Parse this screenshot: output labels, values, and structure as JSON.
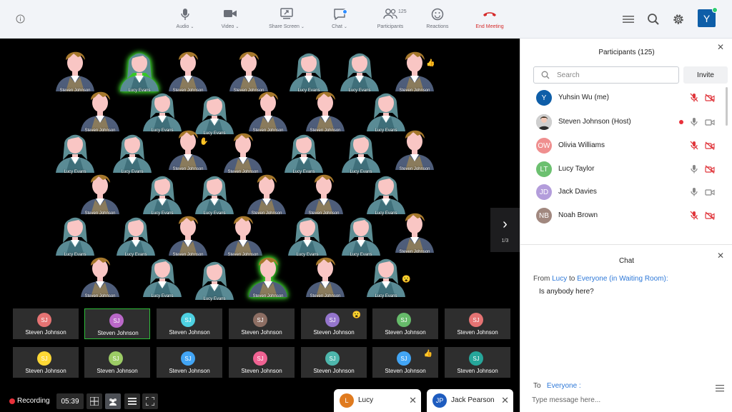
{
  "toolbar": {
    "info_icon": "info-icon",
    "buttons": [
      {
        "id": "audio",
        "label": "Audio",
        "icon": "microphone-icon",
        "caret": "⌄"
      },
      {
        "id": "video",
        "label": "Video",
        "icon": "video-camera-icon",
        "caret": "⌄"
      },
      {
        "id": "share",
        "label": "Share Screen",
        "icon": "share-screen-icon",
        "caret": "⌄"
      },
      {
        "id": "chat",
        "label": "Chat",
        "icon": "chat-bubble-icon",
        "caret": "⌄"
      },
      {
        "id": "participants",
        "label": "Participants",
        "icon": "participants-icon",
        "badge": "125"
      },
      {
        "id": "reactions",
        "label": "Reactions",
        "icon": "smiley-icon"
      },
      {
        "id": "end",
        "label": "End Meeting",
        "icon": "phone-hangup-icon"
      }
    ],
    "avatar_initial": "Y",
    "colors": {
      "end": "#d52b2b",
      "accent": "#2d8cff",
      "avatar": "#0e5ea8"
    }
  },
  "gallery": {
    "people": [
      {
        "name": "Steven Johnson"
      },
      {
        "name": "Lucy Evans"
      },
      {
        "name": "Steven Johnson"
      },
      {
        "name": "Steven Johnson"
      },
      {
        "name": "Lucy Evans"
      },
      {
        "name": "Lucy Evans"
      },
      {
        "name": "Steven Johnson"
      },
      {
        "name": "Steven Johnson"
      },
      {
        "name": "Lucy Evans"
      },
      {
        "name": "Lucy Evans"
      },
      {
        "name": "Steven Johnson"
      },
      {
        "name": "Steven Johnson"
      },
      {
        "name": "Lucy Evans"
      },
      {
        "name": "Lucy Evans"
      },
      {
        "name": "Lucy Evans"
      },
      {
        "name": "Steven Johnson"
      },
      {
        "name": "Steven Johnson"
      },
      {
        "name": "Lucy Evans"
      },
      {
        "name": "Lucy Evans"
      },
      {
        "name": "Steven Johnson"
      },
      {
        "name": "Steven Johnson"
      },
      {
        "name": "Lucy Evans"
      },
      {
        "name": "Lucy Evans"
      },
      {
        "name": "Steven Johnson"
      },
      {
        "name": "Steven Johnson"
      },
      {
        "name": "Lucy Evans"
      },
      {
        "name": "Lucy Evans"
      },
      {
        "name": "Lucy Evans"
      },
      {
        "name": "Steven Johnson"
      },
      {
        "name": "Steven Johnson"
      },
      {
        "name": "Lucy Evans"
      },
      {
        "name": "Lucy Evans"
      },
      {
        "name": "Steven Johnson"
      },
      {
        "name": "Steven Johnson"
      },
      {
        "name": "Lucy Evans"
      },
      {
        "name": "Lucy Evans"
      },
      {
        "name": "Steven Johnson"
      },
      {
        "name": "Steven Johnson"
      },
      {
        "name": "Lucy Evans"
      }
    ],
    "pager": {
      "label": "1/3",
      "icon": "chevron-right-icon"
    },
    "tiles_row1": [
      {
        "initials": "SJ",
        "name": "Steven Johnson",
        "color": "#e57373"
      },
      {
        "initials": "SJ",
        "name": "Steven Johnson",
        "color": "#ba68c8"
      },
      {
        "initials": "SJ",
        "name": "Steven Johnson",
        "color": "#4dd0e1"
      },
      {
        "initials": "SJ",
        "name": "Steven Johnson",
        "color": "#8d6e63"
      },
      {
        "initials": "SJ",
        "name": "Steven Johnson",
        "color": "#9575cd"
      },
      {
        "initials": "SJ",
        "name": "Steven Johnson",
        "color": "#66bb6a"
      },
      {
        "initials": "SJ",
        "name": "Steven Johnson",
        "color": "#e57373"
      }
    ],
    "tiles_row2": [
      {
        "initials": "SJ",
        "name": "Steven Johnson",
        "color": "#fdd835"
      },
      {
        "initials": "SJ",
        "name": "Steven Johnson",
        "color": "#9ccc65"
      },
      {
        "initials": "SJ",
        "name": "Steven Johnson",
        "color": "#42a5f5"
      },
      {
        "initials": "SJ",
        "name": "Steven Johnson",
        "color": "#f06292"
      },
      {
        "initials": "SJ",
        "name": "Steven Johnson",
        "color": "#4db6ac"
      },
      {
        "initials": "SJ",
        "name": "Steven Johnson",
        "color": "#42a5f5"
      },
      {
        "initials": "SJ",
        "name": "Steven Johnson",
        "color": "#26a69a"
      }
    ]
  },
  "bottom": {
    "recording_label": "Recording",
    "timer": "05:39",
    "chips": [
      {
        "initial": "L",
        "name": "Lucy",
        "color": "#e07b1f"
      },
      {
        "initial": "JP",
        "name": "Jack Pearson",
        "color": "#1e5cbf"
      }
    ]
  },
  "participants": {
    "title": "Participants (125)",
    "search_placeholder": "Search",
    "invite_label": "Invite",
    "list": [
      {
        "initials": "Y",
        "name": "Yuhsin Wu (me)",
        "color": "#0e5ea8",
        "mic": "muted",
        "cam": "off"
      },
      {
        "initials": "",
        "name": "Steven Johnson (Host)",
        "color": "#9e9e9e",
        "mic": "on",
        "cam": "on",
        "recording": true
      },
      {
        "initials": "OW",
        "name": "Olivia Williams",
        "color": "#ef8f8f",
        "mic": "muted",
        "cam": "off"
      },
      {
        "initials": "LT",
        "name": "Lucy Taylor",
        "color": "#6cc070",
        "mic": "on",
        "cam": "off"
      },
      {
        "initials": "JD",
        "name": "Jack Davies",
        "color": "#b39ddb",
        "mic": "on",
        "cam": "on"
      },
      {
        "initials": "NB",
        "name": "Noah Brown",
        "color": "#a1887f",
        "mic": "muted",
        "cam": "off"
      }
    ]
  },
  "chat": {
    "title": "Chat",
    "from_prefix": "From",
    "from_name": "Lucy",
    "to_word": "to",
    "to_target": "Everyone (in Waiting Room):",
    "message": "Is anybody here?",
    "to_label": "To",
    "to_value": "Everyone :",
    "input_placeholder": "Type message here..."
  }
}
